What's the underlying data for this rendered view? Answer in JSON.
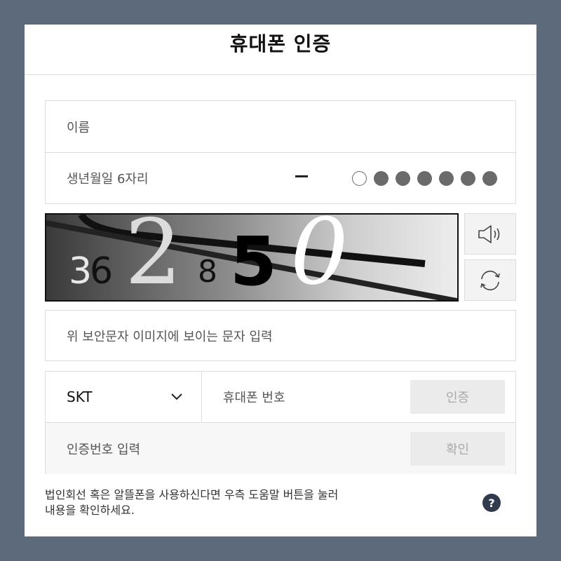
{
  "modal": {
    "title": "휴대폰 인증"
  },
  "form": {
    "name_placeholder": "이름",
    "birth_label": "생년월일 6자리",
    "rrn_mask": {
      "filled_dots": 6,
      "empty_dots": 1
    },
    "captcha": {
      "chars": [
        "3",
        "6",
        "2",
        "8",
        "5",
        "0"
      ],
      "input_placeholder": "위 보안문자 이미지에 보이는 문자 입력"
    },
    "carrier": {
      "selected": "SKT"
    },
    "phone_placeholder": "휴대폰 번호",
    "verify_button": "인증",
    "code_placeholder": "인증번호 입력",
    "confirm_button": "확인"
  },
  "help": {
    "line1": "법인회선 혹은 알뜰폰을 사용하신다면 우측 도움말 버튼을 눌러",
    "line2": "내용을 확인하세요.",
    "button": "?"
  },
  "icons": {
    "audio": "speaker-icon",
    "refresh": "refresh-icon",
    "dropdown": "chevron-down-icon"
  },
  "colors": {
    "backdrop": "#5c6a7c",
    "dot": "#6a6a6a",
    "help_button": "#323a4e"
  }
}
